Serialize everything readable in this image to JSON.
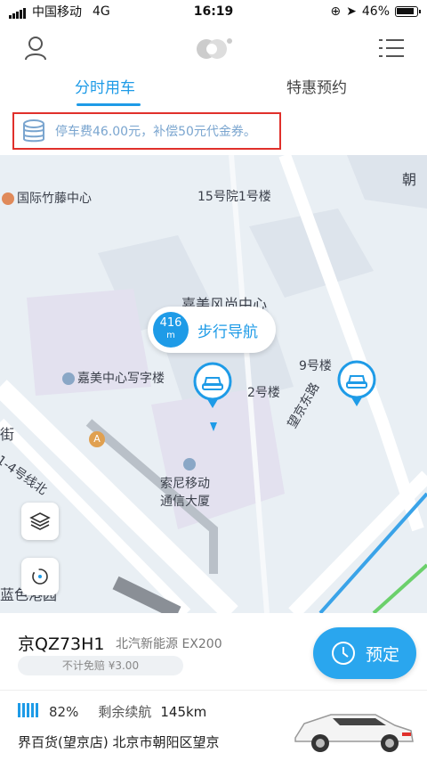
{
  "status_bar": {
    "carrier": "中国移动",
    "network": "4G",
    "time": "16:19",
    "battery_percent": "46%"
  },
  "header": {
    "user_icon": "user-icon",
    "logo_icon": "app-logo-icon",
    "menu_icon": "list-menu-icon"
  },
  "tabs": [
    {
      "label": "分时用车",
      "active": true
    },
    {
      "label": "特惠预约",
      "active": false
    }
  ],
  "notice": {
    "icon": "coin-stack-icon",
    "text": "停车费46.00元，补偿50元代金券。"
  },
  "map": {
    "labels": {
      "zhuteng": "国际竹藤中心",
      "building15": "15号院1号楼",
      "chao": "朝",
      "jiamei": "嘉美风尚中心",
      "jiamei_office": "嘉美中心写字楼",
      "building9": "9号楼",
      "building2": "2号楼",
      "wangjing_east": "望京东路",
      "jie": "街",
      "line14": "1-4号线北",
      "sony": "索尼移动",
      "sony2": "通信大厦",
      "blue_harbor": "蓝色港园",
      "poi_a": "A"
    },
    "walk_nav": {
      "distance": "416",
      "unit": "m",
      "label": "步行导航"
    },
    "accent_color": "#1e9be7"
  },
  "vehicle": {
    "plate": "京QZ73H1",
    "model": "北汽新能源 EX200",
    "waiver_text": "不计免赔 ¥3.00",
    "book_label": "预定",
    "battery": "82%",
    "range_label": "剩余续航",
    "range_value": "145km",
    "address": "界百货(望京店) 北京市朝阳区望京"
  }
}
